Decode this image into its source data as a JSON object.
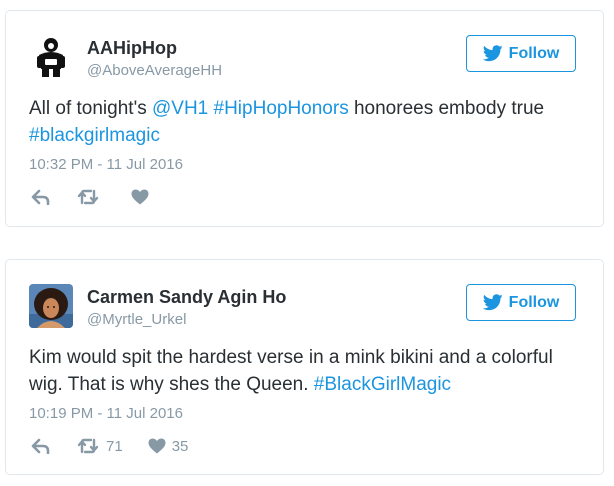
{
  "tweets": [
    {
      "name": "AAHipHop",
      "handle": "@AboveAverageHH",
      "follow_label": "Follow",
      "text_segments": [
        {
          "text": "All of tonight's ",
          "link": false
        },
        {
          "text": "@VH1",
          "link": true
        },
        {
          "text": " ",
          "link": false
        },
        {
          "text": "#HipHopHonors",
          "link": true
        },
        {
          "text": " honorees embody true ",
          "link": false
        },
        {
          "text": "#blackgirlmagic",
          "link": true
        }
      ],
      "timestamp": "10:32 PM - 11 Jul 2016",
      "retweet_count": "",
      "like_count": ""
    },
    {
      "name": "Carmen Sandy Agin Ho",
      "handle": "@Myrtle_Urkel",
      "follow_label": "Follow",
      "text_segments": [
        {
          "text": "Kim would spit the hardest verse in a mink bikini and a colorful wig. That is why shes the Queen. ",
          "link": false
        },
        {
          "text": "#BlackGirlMagic",
          "link": true
        }
      ],
      "timestamp": "10:19 PM - 11 Jul 2016",
      "retweet_count": "71",
      "like_count": "35"
    }
  ],
  "colors": {
    "link": "#1b95e0",
    "meta": "#8899a6",
    "text": "#292f33",
    "border": "#e1e8ed"
  },
  "icons": {
    "follow": "twitter-bird-icon",
    "reply": "reply-icon",
    "retweet": "retweet-icon",
    "like": "heart-icon"
  }
}
